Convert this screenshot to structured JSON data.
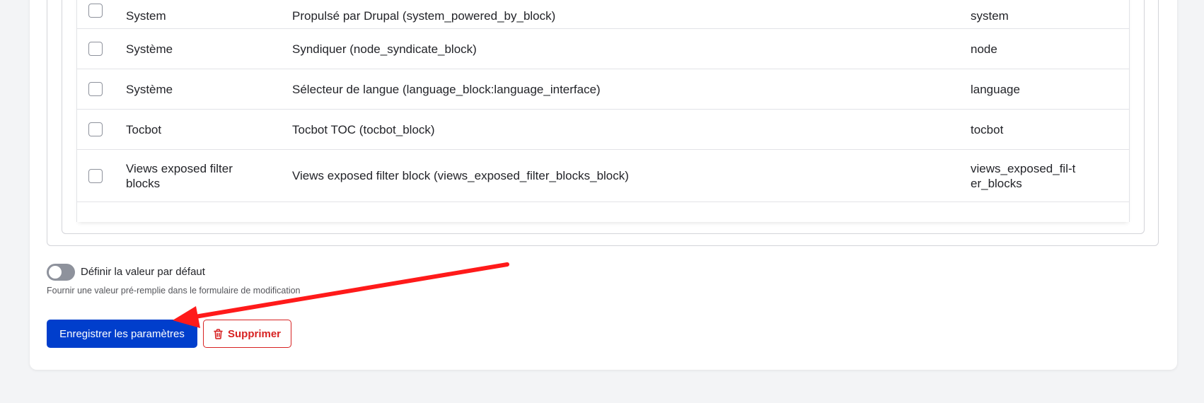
{
  "table": {
    "rows": [
      {
        "category": "System",
        "name": "Propulsé par Drupal (system_powered_by_block)",
        "provider": "system"
      },
      {
        "category": "Système",
        "name": "Syndiquer (node_syndicate_block)",
        "provider": "node"
      },
      {
        "category": "Système",
        "name": "Sélecteur de langue (language_block:language_interface)",
        "provider": "language"
      },
      {
        "category": "Tocbot",
        "name": "Tocbot TOC (tocbot_block)",
        "provider": "tocbot"
      },
      {
        "category": "Views exposed filter blocks",
        "name": "Views exposed filter block (views_exposed_filter_blocks_block)",
        "provider": "views_exposed_fil-ter_blocks"
      }
    ]
  },
  "default_value": {
    "toggle_label": "Définir la valeur par défaut",
    "description": "Fournir une valeur pré-remplie dans le formulaire de modification",
    "enabled": false
  },
  "actions": {
    "save_label": "Enregistrer les paramètres",
    "delete_label": "Supprimer"
  },
  "icons": {
    "delete": "trash-icon"
  },
  "colors": {
    "primary": "#003ecc",
    "danger": "#d72222",
    "annotation_arrow": "#ff0000"
  }
}
